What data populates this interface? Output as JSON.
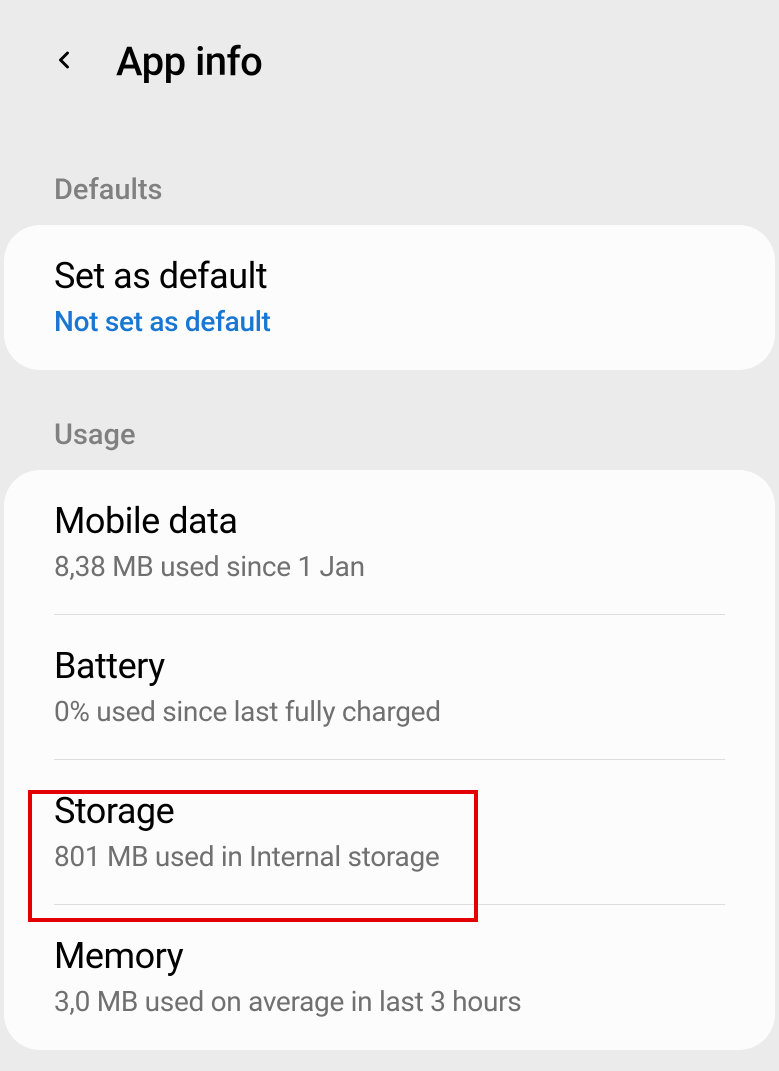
{
  "header": {
    "title": "App info"
  },
  "sections": {
    "defaults": {
      "header": "Defaults",
      "items": {
        "set_default": {
          "title": "Set as default",
          "subtitle": "Not set as default"
        }
      }
    },
    "usage": {
      "header": "Usage",
      "items": {
        "mobile_data": {
          "title": "Mobile data",
          "subtitle": "8,38 MB used since 1 Jan"
        },
        "battery": {
          "title": "Battery",
          "subtitle": "0% used since last fully charged"
        },
        "storage": {
          "title": "Storage",
          "subtitle": "801 MB used in Internal storage"
        },
        "memory": {
          "title": "Memory",
          "subtitle": "3,0 MB used on average in last 3 hours"
        }
      }
    }
  }
}
